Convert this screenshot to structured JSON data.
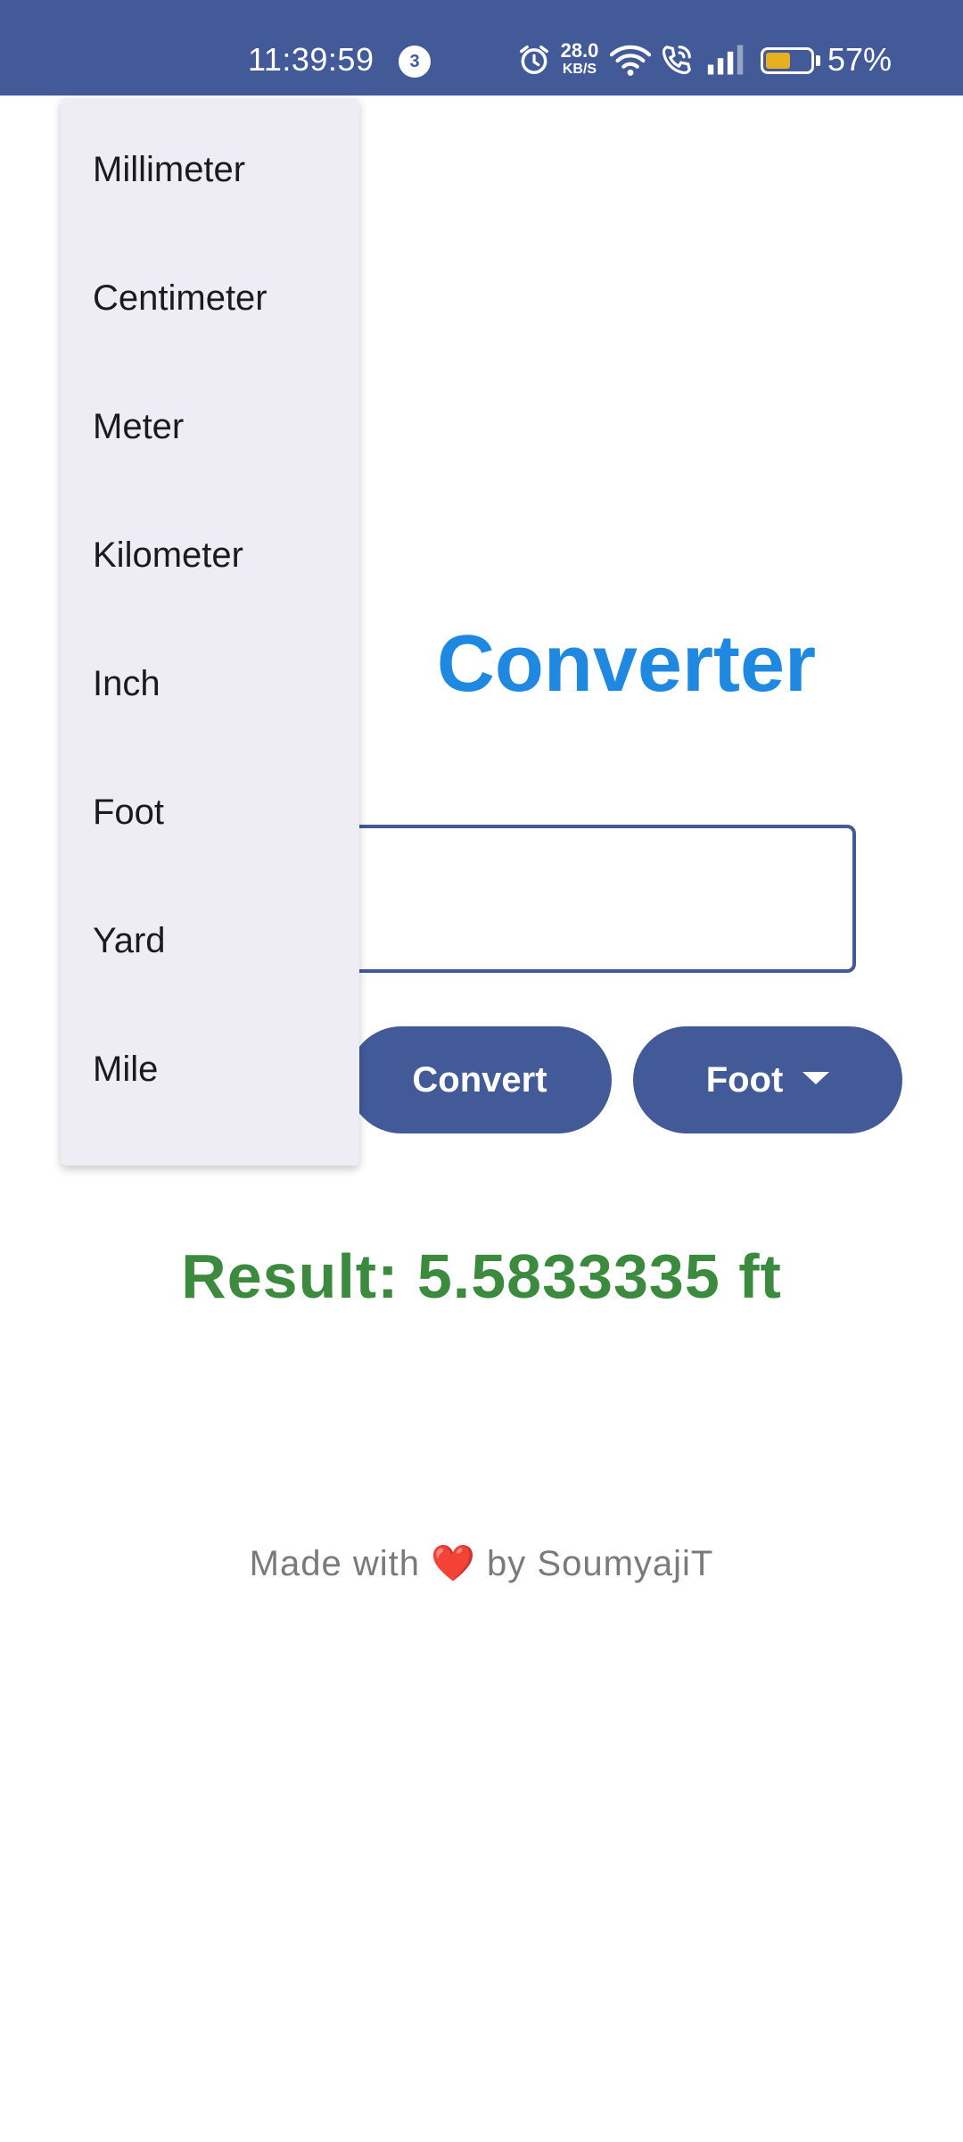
{
  "status_bar": {
    "time": "11:39:59",
    "notification_count": "3",
    "net_speed_value": "28.0",
    "net_speed_unit": "KB/S",
    "battery_percent": "57%",
    "battery_level": 0.57,
    "icons": [
      "alarm-icon",
      "wifi-icon",
      "wifi-calling-icon",
      "signal-icon",
      "battery-icon"
    ],
    "colors": {
      "background": "#435a98",
      "battery_fill": "#e6b020"
    }
  },
  "main": {
    "title_visible": "Converter",
    "input": {
      "value": "",
      "placeholder": ""
    },
    "convert_button": "Convert",
    "unit_button": "Foot",
    "result": "Result: 5.5833335 ft",
    "footer_prefix": "Made with",
    "footer_heart": "❤️",
    "footer_suffix": "by SoumyajiT"
  },
  "dropdown": {
    "items": [
      {
        "label": "Millimeter"
      },
      {
        "label": "Centimeter"
      },
      {
        "label": "Meter"
      },
      {
        "label": "Kilometer"
      },
      {
        "label": "Inch"
      },
      {
        "label": "Foot"
      },
      {
        "label": "Yard"
      },
      {
        "label": "Mile"
      }
    ]
  },
  "colors": {
    "primary": "#435a98",
    "title": "#1f88e0",
    "result": "#3b8a3e",
    "footer": "#7a7a7a",
    "menu_bg": "#eeedf5"
  }
}
